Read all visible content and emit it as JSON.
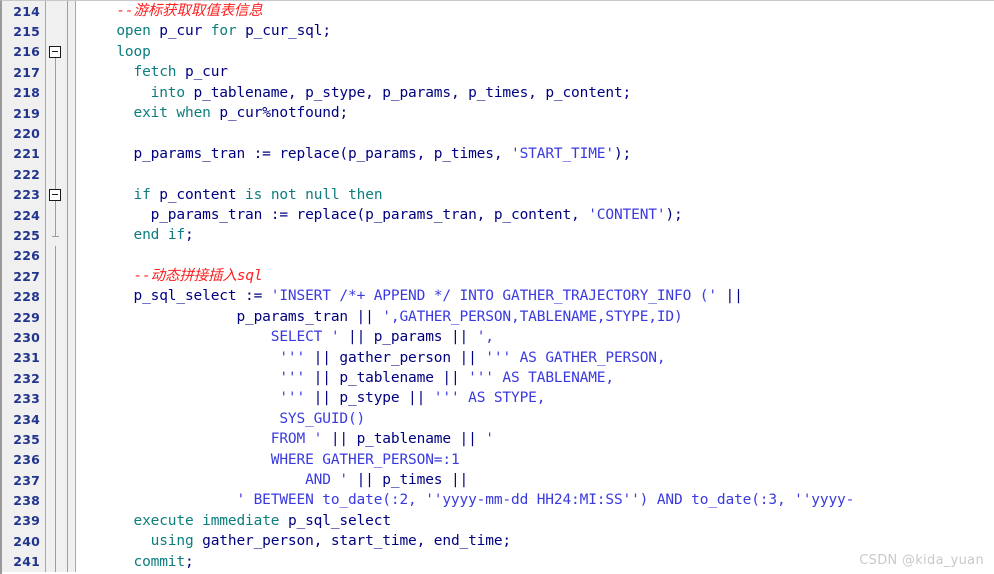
{
  "editor": {
    "first_line_number": 214,
    "watermark": "CSDN @kida_yuan",
    "colors": {
      "keyword": "#0d7d7d",
      "identifier": "#000080",
      "string": "#3a3ae0",
      "comment": "#ff2020",
      "gutter_background": "#f0f0f0",
      "gutter_text": "#22358c",
      "editor_background": "#ffffff"
    }
  },
  "lines": [
    {
      "number": "214",
      "fold": "none",
      "guide": "none",
      "text": "    --游标获取取值表信息",
      "tokens": [
        {
          "t": "    ",
          "c": "id"
        },
        {
          "t": "--游标获取取值表信息",
          "c": "cmt"
        }
      ]
    },
    {
      "number": "215",
      "fold": "none",
      "guide": "none",
      "text": "    open p_cur for p_cur_sql;",
      "tokens": [
        {
          "t": "    ",
          "c": "id"
        },
        {
          "t": "open",
          "c": "kw"
        },
        {
          "t": " ",
          "c": "id"
        },
        {
          "t": "p_cur",
          "c": "id"
        },
        {
          "t": " ",
          "c": "id"
        },
        {
          "t": "for",
          "c": "kw"
        },
        {
          "t": " ",
          "c": "id"
        },
        {
          "t": "p_cur_sql",
          "c": "id"
        },
        {
          "t": ";",
          "c": "op"
        }
      ]
    },
    {
      "number": "216",
      "fold": "collapse",
      "guide": "start",
      "text": "    loop",
      "tokens": [
        {
          "t": "    ",
          "c": "id"
        },
        {
          "t": "loop",
          "c": "kw"
        }
      ]
    },
    {
      "number": "217",
      "fold": "none",
      "guide": "full",
      "text": "      fetch p_cur",
      "tokens": [
        {
          "t": "      ",
          "c": "id"
        },
        {
          "t": "fetch",
          "c": "kw"
        },
        {
          "t": " ",
          "c": "id"
        },
        {
          "t": "p_cur",
          "c": "id"
        }
      ]
    },
    {
      "number": "218",
      "fold": "none",
      "guide": "full",
      "text": "        into p_tablename, p_stype, p_params, p_times, p_content;",
      "tokens": [
        {
          "t": "        ",
          "c": "id"
        },
        {
          "t": "into",
          "c": "kw"
        },
        {
          "t": " p_tablename, p_stype, p_params, p_times, p_content;",
          "c": "id"
        }
      ]
    },
    {
      "number": "219",
      "fold": "none",
      "guide": "full",
      "text": "      exit when p_cur%notfound;",
      "tokens": [
        {
          "t": "      ",
          "c": "id"
        },
        {
          "t": "exit",
          "c": "kw"
        },
        {
          "t": " ",
          "c": "id"
        },
        {
          "t": "when",
          "c": "kw"
        },
        {
          "t": " ",
          "c": "id"
        },
        {
          "t": "p_cur%notfound",
          "c": "id"
        },
        {
          "t": ";",
          "c": "op"
        }
      ]
    },
    {
      "number": "220",
      "fold": "none",
      "guide": "full",
      "text": "",
      "tokens": []
    },
    {
      "number": "221",
      "fold": "none",
      "guide": "full",
      "text": "      p_params_tran := replace(p_params, p_times, 'START_TIME');",
      "tokens": [
        {
          "t": "      ",
          "c": "id"
        },
        {
          "t": "p_params_tran := replace(p_params, p_times, ",
          "c": "id"
        },
        {
          "t": "'START_TIME'",
          "c": "str"
        },
        {
          "t": ");",
          "c": "id"
        }
      ]
    },
    {
      "number": "222",
      "fold": "none",
      "guide": "full",
      "text": "",
      "tokens": []
    },
    {
      "number": "223",
      "fold": "collapse",
      "guide": "full",
      "text": "      if p_content is not null then",
      "tokens": [
        {
          "t": "      ",
          "c": "id"
        },
        {
          "t": "if",
          "c": "kw"
        },
        {
          "t": " p_content ",
          "c": "id"
        },
        {
          "t": "is",
          "c": "kw"
        },
        {
          "t": " ",
          "c": "id"
        },
        {
          "t": "not",
          "c": "kw"
        },
        {
          "t": " ",
          "c": "id"
        },
        {
          "t": "null",
          "c": "kw"
        },
        {
          "t": " ",
          "c": "id"
        },
        {
          "t": "then",
          "c": "kw"
        }
      ]
    },
    {
      "number": "224",
      "fold": "none",
      "guide": "full",
      "text": "        p_params_tran := replace(p_params_tran, p_content, 'CONTENT');",
      "tokens": [
        {
          "t": "        ",
          "c": "id"
        },
        {
          "t": "p_params_tran := replace(p_params_tran, p_content, ",
          "c": "id"
        },
        {
          "t": "'CONTENT'",
          "c": "str"
        },
        {
          "t": ");",
          "c": "id"
        }
      ]
    },
    {
      "number": "225",
      "fold": "none",
      "guide": "end",
      "text": "      end if;",
      "tokens": [
        {
          "t": "      ",
          "c": "id"
        },
        {
          "t": "end",
          "c": "kw"
        },
        {
          "t": " ",
          "c": "id"
        },
        {
          "t": "if",
          "c": "kw"
        },
        {
          "t": ";",
          "c": "op"
        }
      ]
    },
    {
      "number": "226",
      "fold": "none",
      "guide": "full",
      "text": "",
      "tokens": []
    },
    {
      "number": "227",
      "fold": "none",
      "guide": "full",
      "text": "      --动态拼接插入sql",
      "tokens": [
        {
          "t": "      ",
          "c": "id"
        },
        {
          "t": "--动态拼接插入sql",
          "c": "cmt"
        }
      ]
    },
    {
      "number": "228",
      "fold": "none",
      "guide": "full",
      "text": "      p_sql_select := 'INSERT /*+ APPEND */ INTO GATHER_TRAJECTORY_INFO (' ||",
      "tokens": [
        {
          "t": "      ",
          "c": "id"
        },
        {
          "t": "p_sql_select := ",
          "c": "id"
        },
        {
          "t": "'INSERT /*+ APPEND */ INTO GATHER_TRAJECTORY_INFO ('",
          "c": "str"
        },
        {
          "t": " || ",
          "c": "id"
        }
      ]
    },
    {
      "number": "229",
      "fold": "none",
      "guide": "full",
      "text": "                  p_params_tran || ',GATHER_PERSON,TABLENAME,STYPE,ID)",
      "tokens": [
        {
          "t": "                  ",
          "c": "id"
        },
        {
          "t": "p_params_tran || ",
          "c": "id"
        },
        {
          "t": "',GATHER_PERSON,TABLENAME,STYPE,ID)",
          "c": "str"
        }
      ]
    },
    {
      "number": "230",
      "fold": "none",
      "guide": "full",
      "text": "                      SELECT ' || p_params || ',",
      "tokens": [
        {
          "t": "                      ",
          "c": "id"
        },
        {
          "t": "SELECT '",
          "c": "str"
        },
        {
          "t": " || p_params || ",
          "c": "id"
        },
        {
          "t": "',",
          "c": "str"
        }
      ]
    },
    {
      "number": "231",
      "fold": "none",
      "guide": "full",
      "text": "                       ''' || gather_person || ''' AS GATHER_PERSON,",
      "tokens": [
        {
          "t": "                       ",
          "c": "id"
        },
        {
          "t": "'''",
          "c": "str"
        },
        {
          "t": " || gather_person || ",
          "c": "id"
        },
        {
          "t": "''' AS GATHER_PERSON,",
          "c": "str"
        }
      ]
    },
    {
      "number": "232",
      "fold": "none",
      "guide": "full",
      "text": "                       ''' || p_tablename || ''' AS TABLENAME,",
      "tokens": [
        {
          "t": "                       ",
          "c": "id"
        },
        {
          "t": "'''",
          "c": "str"
        },
        {
          "t": " || p_tablename || ",
          "c": "id"
        },
        {
          "t": "''' AS TABLENAME,",
          "c": "str"
        }
      ]
    },
    {
      "number": "233",
      "fold": "none",
      "guide": "full",
      "text": "                       ''' || p_stype || ''' AS STYPE,",
      "tokens": [
        {
          "t": "                       ",
          "c": "id"
        },
        {
          "t": "'''",
          "c": "str"
        },
        {
          "t": " || p_stype || ",
          "c": "id"
        },
        {
          "t": "''' AS STYPE,",
          "c": "str"
        }
      ]
    },
    {
      "number": "234",
      "fold": "none",
      "guide": "full",
      "text": "                       SYS_GUID()",
      "tokens": [
        {
          "t": "                       ",
          "c": "id"
        },
        {
          "t": "SYS_GUID()",
          "c": "str"
        }
      ]
    },
    {
      "number": "235",
      "fold": "none",
      "guide": "full",
      "text": "                      FROM ' || p_tablename || '",
      "tokens": [
        {
          "t": "                      ",
          "c": "id"
        },
        {
          "t": "FROM '",
          "c": "str"
        },
        {
          "t": " || p_tablename || ",
          "c": "id"
        },
        {
          "t": "'",
          "c": "str"
        }
      ]
    },
    {
      "number": "236",
      "fold": "none",
      "guide": "full",
      "text": "                      WHERE GATHER_PERSON=:1",
      "tokens": [
        {
          "t": "                      ",
          "c": "id"
        },
        {
          "t": "WHERE GATHER_PERSON=:1",
          "c": "str"
        }
      ]
    },
    {
      "number": "237",
      "fold": "none",
      "guide": "full",
      "text": "                          AND ' || p_times ||",
      "tokens": [
        {
          "t": "                          ",
          "c": "id"
        },
        {
          "t": "AND '",
          "c": "str"
        },
        {
          "t": " || p_times ||",
          "c": "id"
        }
      ]
    },
    {
      "number": "238",
      "fold": "none",
      "guide": "full",
      "text": "                  ' BETWEEN to_date(:2, ''yyyy-mm-dd HH24:MI:SS'') AND to_date(:3, ''yyyy-",
      "tokens": [
        {
          "t": "                  ",
          "c": "id"
        },
        {
          "t": "' BETWEEN to_date(:2, ''yyyy-mm-dd HH24:MI:SS'') AND to_date(:3, ''yyyy-",
          "c": "str"
        }
      ]
    },
    {
      "number": "239",
      "fold": "none",
      "guide": "full",
      "text": "      execute immediate p_sql_select",
      "tokens": [
        {
          "t": "      ",
          "c": "id"
        },
        {
          "t": "execute",
          "c": "kw"
        },
        {
          "t": " ",
          "c": "id"
        },
        {
          "t": "immediate",
          "c": "kw"
        },
        {
          "t": " p_sql_select",
          "c": "id"
        }
      ]
    },
    {
      "number": "240",
      "fold": "none",
      "guide": "full",
      "text": "        using gather_person, start_time, end_time;",
      "tokens": [
        {
          "t": "        ",
          "c": "id"
        },
        {
          "t": "using",
          "c": "kw"
        },
        {
          "t": " gather_person, start_time, end_time;",
          "c": "id"
        }
      ]
    },
    {
      "number": "241",
      "fold": "none",
      "guide": "full",
      "text": "      commit;",
      "tokens": [
        {
          "t": "      ",
          "c": "id"
        },
        {
          "t": "commit",
          "c": "kw"
        },
        {
          "t": ";",
          "c": "op"
        }
      ]
    }
  ]
}
